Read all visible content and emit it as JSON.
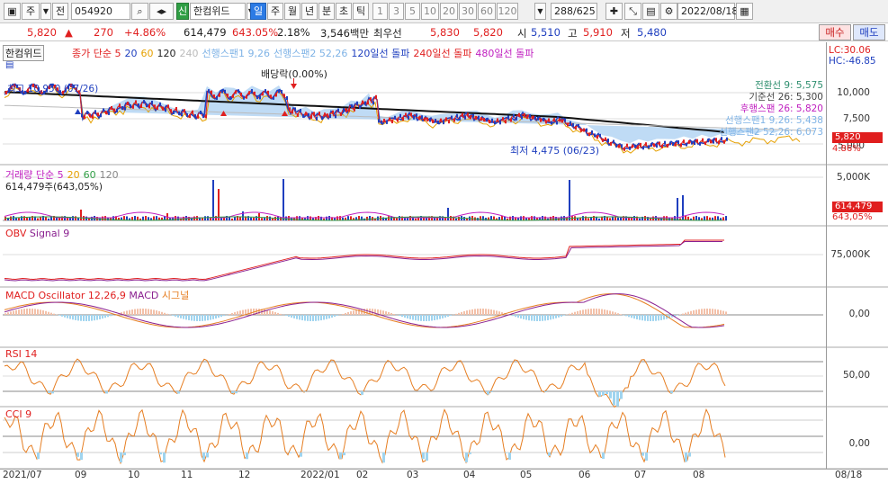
{
  "toolbar": {
    "mode": "주",
    "prev": "전",
    "code": "054920",
    "market_badge": "신",
    "name": "한컴위드",
    "periods": [
      "일",
      "주",
      "월",
      "년",
      "분",
      "초",
      "틱"
    ],
    "numbers": [
      "1",
      "3",
      "5",
      "10",
      "20",
      "30",
      "60",
      "120"
    ],
    "count": "288/625",
    "date": "2022/08/18"
  },
  "quote": {
    "price": "5,820",
    "arrow": "▲",
    "change": "270",
    "change_pct": "+4.86%",
    "volume": "614,479",
    "vol_pct": "643.05%",
    "turnover_pct": "2.18%",
    "amount": "3,546백만",
    "best_ask_label": "최우선",
    "best_ask": "5,830",
    "best_bid": "5,820",
    "open_label": "시",
    "open": "5,510",
    "high_label": "고",
    "high": "5,910",
    "low_label": "저",
    "low": "5,480",
    "buy_label": "매수",
    "sell_label": "매도"
  },
  "price_panel": {
    "stock_tag": "한컴위드",
    "legend": [
      {
        "text": "종가 단순 5",
        "color": "#e02020"
      },
      {
        "text": "20",
        "color": "#1f3fbf"
      },
      {
        "text": "60",
        "color": "#e6a000"
      },
      {
        "text": "120",
        "color": "#222222"
      },
      {
        "text": "240",
        "color": "#bbbbbb"
      },
      {
        "text": "선행스팬1 9,26",
        "color": "#7fb3e6"
      },
      {
        "text": "선행스팬2 52,26",
        "color": "#7fb3e6"
      },
      {
        "text": "120일선 돌파",
        "color": "#1f3fbf"
      },
      {
        "text": "240일선 돌파",
        "color": "#e02020"
      },
      {
        "text": "480일선 돌파",
        "color": "#c020c0"
      }
    ],
    "lc": "LC:30.06",
    "hc": "HC:-46.85",
    "high_label": "최고 10,950 (07/26)",
    "dividend_label": "배당락(0.00%)",
    "low_label": "최저 4,475 (06/23)",
    "ichimoku": [
      {
        "text": "전환선 9: 5,575",
        "color": "#2f8f6f"
      },
      {
        "text": "기준선 26: 5,300",
        "color": "#444444"
      },
      {
        "text": "후행스팬 26: 5,820",
        "color": "#c020c0"
      },
      {
        "text": "선행스팬1 9,26: 5,438",
        "color": "#7fb3e6"
      },
      {
        "text": "선행스팬2 52,26: 6,073",
        "color": "#7fb3e6"
      }
    ],
    "axis": [
      "10,000",
      "7,500",
      "5,000"
    ],
    "price_box": "5,820",
    "pct_box": "4.86%"
  },
  "volume_panel": {
    "legend": [
      {
        "text": "거래량 단순 5",
        "color": "#c020c0"
      },
      {
        "text": "20",
        "color": "#e6a000"
      },
      {
        "text": "60",
        "color": "#2f9e44"
      },
      {
        "text": "120",
        "color": "#888888"
      }
    ],
    "sub": "614,479주(643,05%)",
    "axis": "5,000K",
    "vol_box": "614,479",
    "pct_box": "643,05%"
  },
  "obv_panel": {
    "label1": "OBV",
    "label2": "Signal 9",
    "axis": "75,000K"
  },
  "macd_panel": {
    "label1": "MACD Oscillator 12,26,9",
    "label2": "MACD",
    "label3": "시그널",
    "axis": "0,00"
  },
  "rsi_panel": {
    "label": "RSI 14",
    "axis": "50,00"
  },
  "cci_panel": {
    "label": "CCI 9",
    "axis": "0,00"
  },
  "dates": [
    "2021/07",
    "09",
    "10",
    "11",
    "12",
    "2022/01",
    "02",
    "03",
    "04",
    "05",
    "06",
    "07",
    "08",
    "08/18"
  ]
}
